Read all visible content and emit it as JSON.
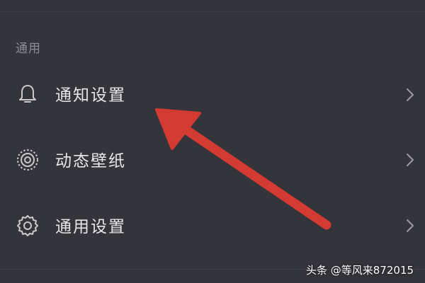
{
  "section": {
    "header": "通用"
  },
  "items": [
    {
      "label": "通知设置",
      "icon": "bell-icon"
    },
    {
      "label": "动态壁纸",
      "icon": "live-wallpaper-icon"
    },
    {
      "label": "通用设置",
      "icon": "gear-icon"
    }
  ],
  "annotation": {
    "arrow_color": "#d33a31",
    "points_to": "通知设置"
  },
  "watermark": {
    "text": "头条 @等风来872015"
  },
  "colors": {
    "background": "#34343b",
    "text": "#e7e7ea",
    "muted": "#8c8c94"
  }
}
